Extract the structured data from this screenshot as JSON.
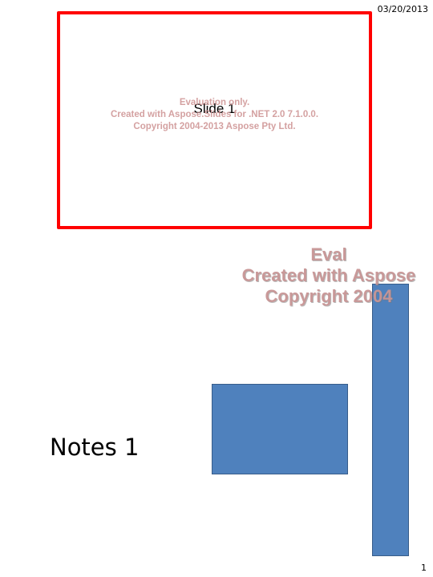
{
  "header": {
    "date": "03/20/2013"
  },
  "slide": {
    "title": "Slide 1",
    "border_color": "#ff0000",
    "watermark": {
      "line1": "Evaluation only.",
      "line2": "Created with Aspose.Slides for .NET 2.0 7.1.0.0.",
      "line3": "Copyright 2004-2013 Aspose Pty Ltd."
    }
  },
  "page_watermark": {
    "line1": "Eval",
    "line2": "Created with Aspose",
    "line3": "Copyright 2004"
  },
  "notes": {
    "text": "Notes 1"
  },
  "shapes": {
    "fill_color": "#4f81bd",
    "outline_color": "#385d8a"
  },
  "footer": {
    "page_number": "1"
  }
}
